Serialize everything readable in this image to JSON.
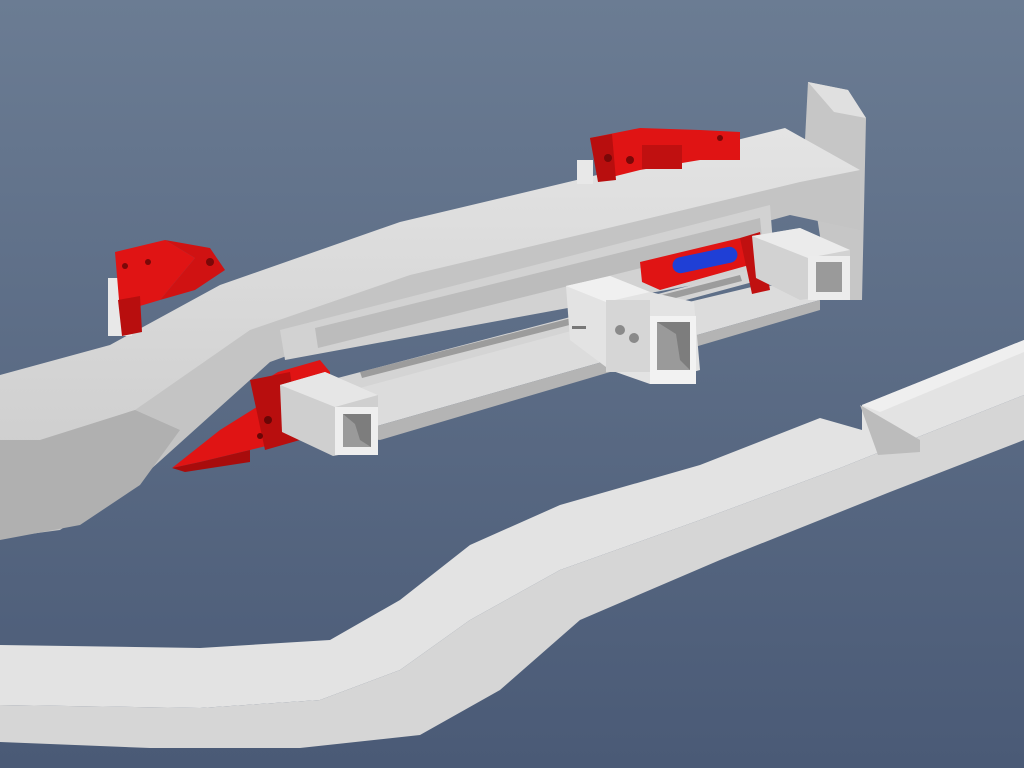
{
  "scene": {
    "subject": "",
    "colors": {
      "background_top": "#6b7c93",
      "background_bottom": "#4a5a76",
      "frame_rail_top": "#d9d9d9",
      "frame_rail_side": "#bdbdbd",
      "frame_rail_shadow": "#a8a8a8",
      "mount_bracket": "#e01414",
      "mount_bracket_dark": "#a80c0c",
      "actuator": "#1f3fd6",
      "tube_inner": "#9a9a9a"
    }
  }
}
